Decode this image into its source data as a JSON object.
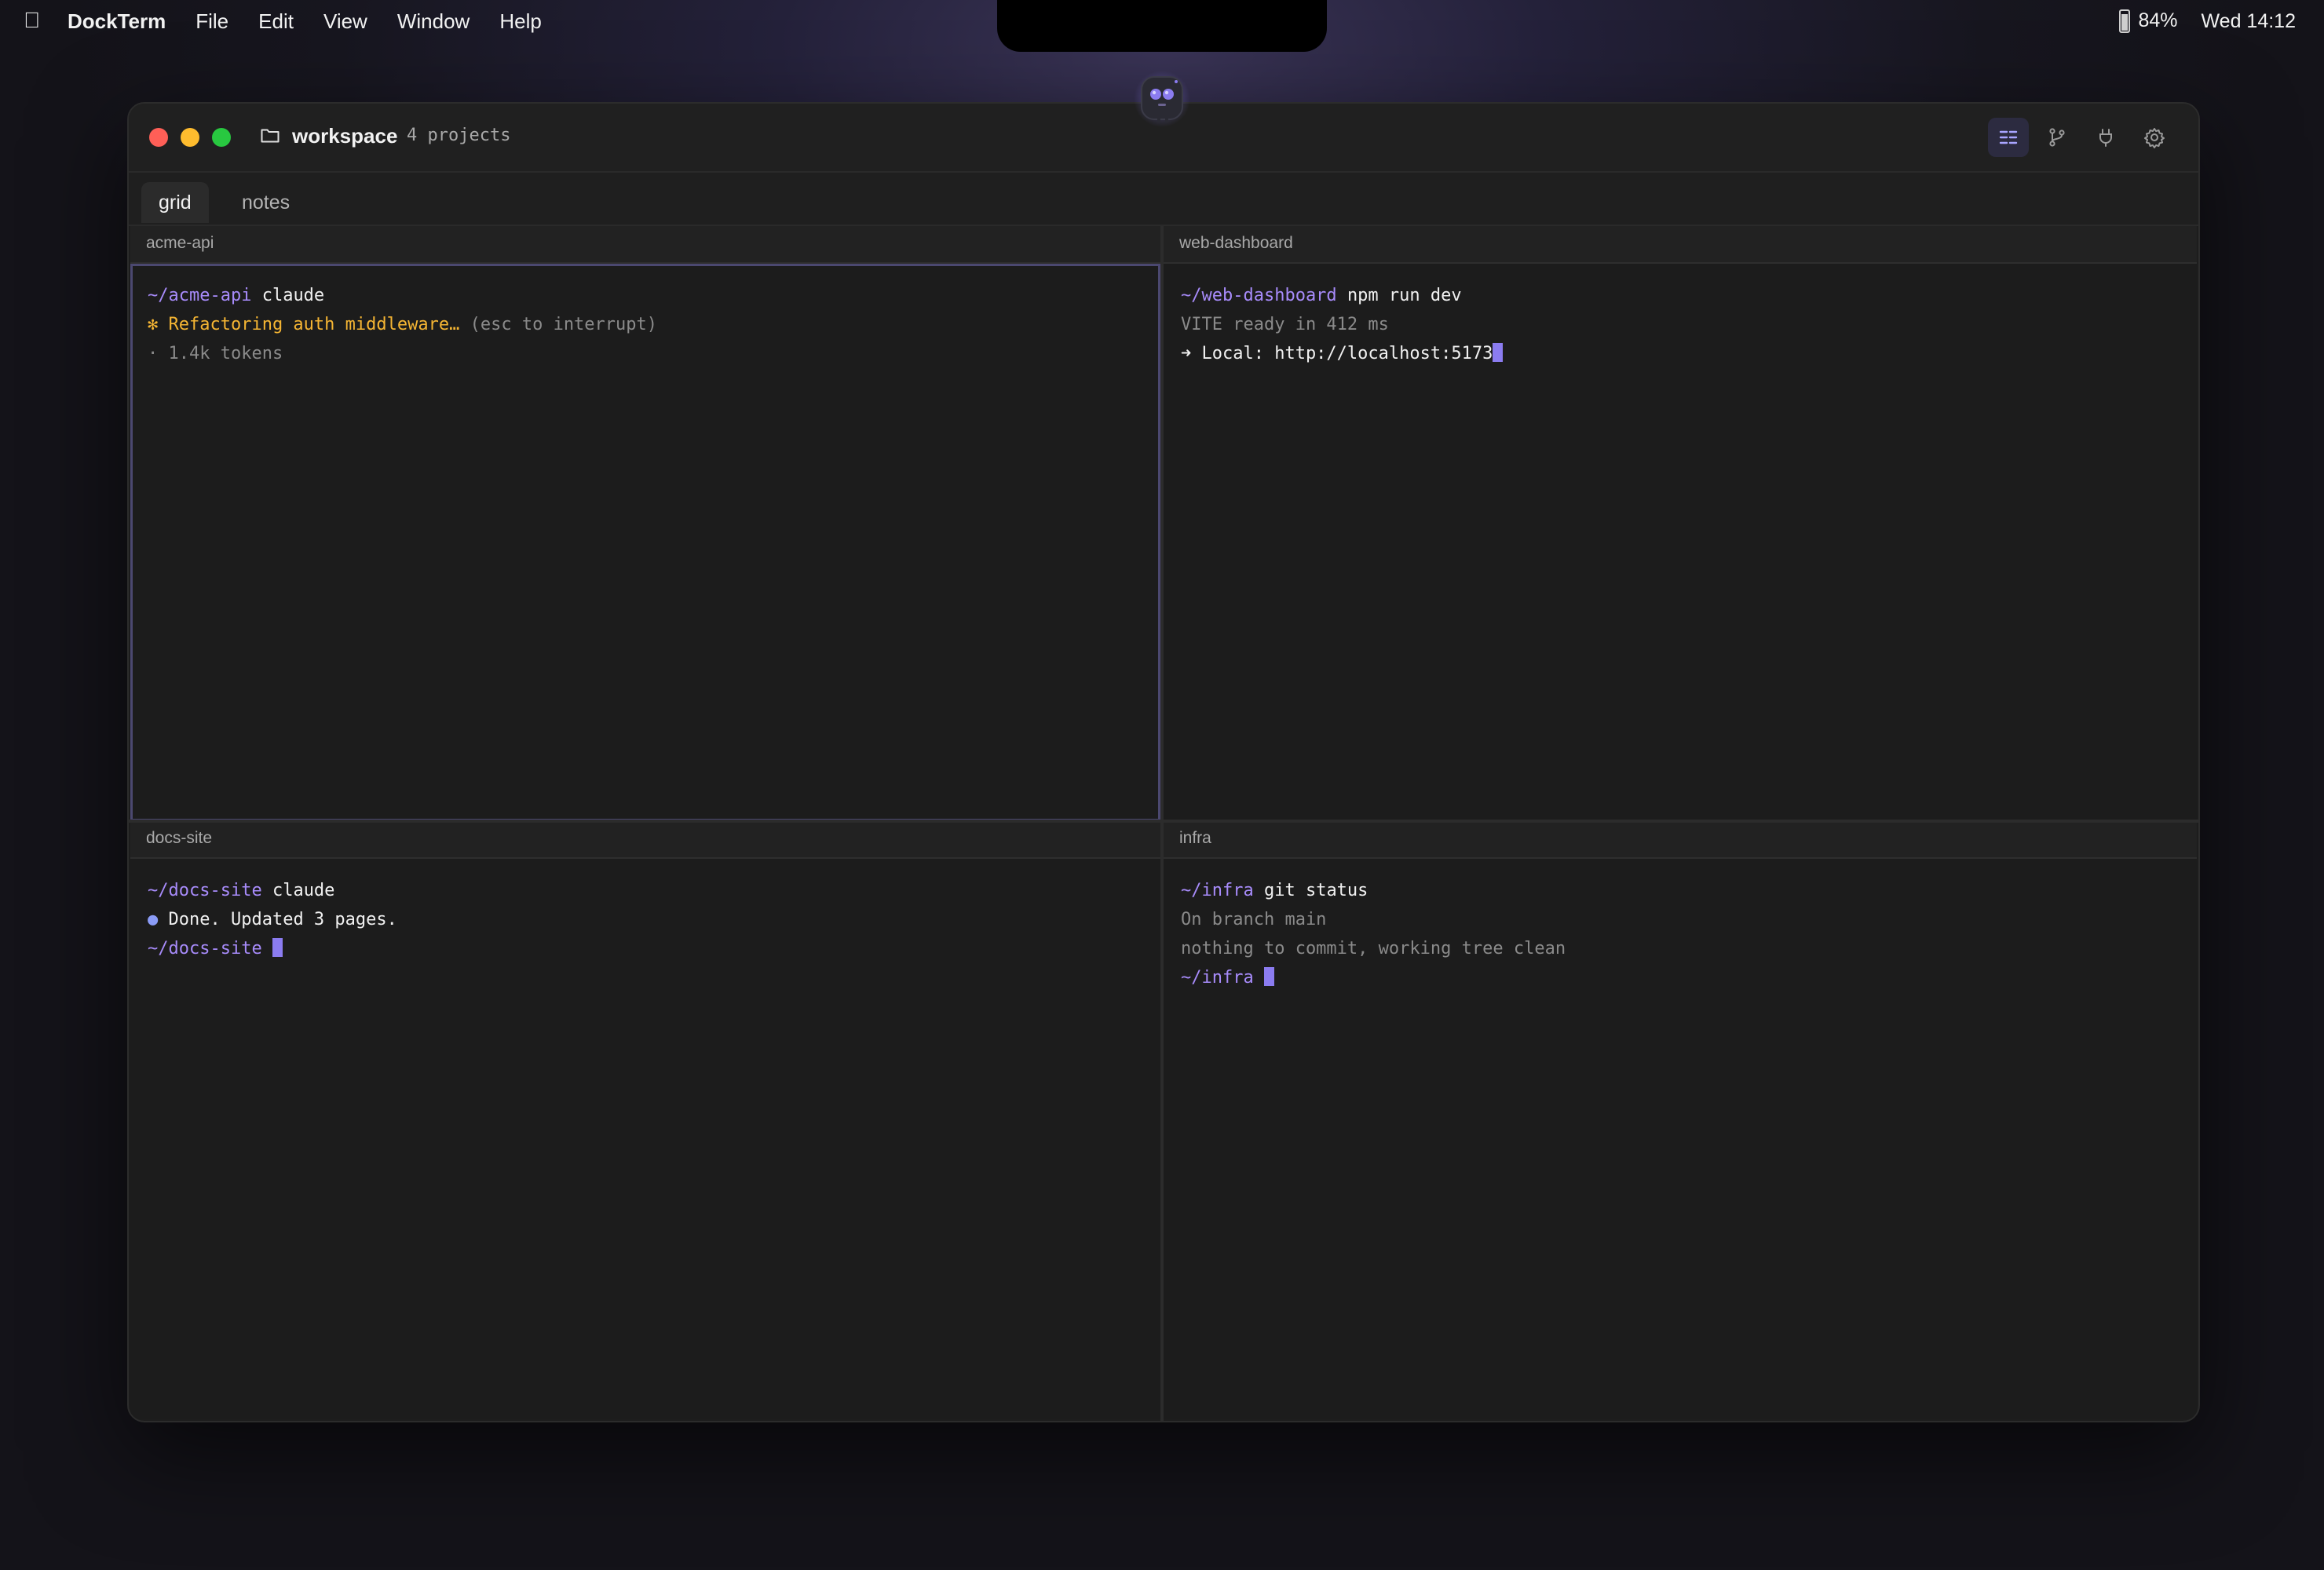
{
  "menubar": {
    "app_name": "DockTerm",
    "menus": [
      "File",
      "Edit",
      "View",
      "Window",
      "Help"
    ],
    "battery": "84%",
    "clock": "Wed 14:12"
  },
  "window": {
    "workspace_name": "workspace",
    "project_count": "4 projects",
    "toolbar_icons": [
      "grid-layout-icon",
      "git-branch-icon",
      "plug-icon",
      "gear-icon"
    ]
  },
  "tabs": [
    {
      "label": "grid",
      "active": true
    },
    {
      "label": "notes",
      "active": false
    }
  ],
  "panes": [
    {
      "title": "acme-api",
      "lines": [
        {
          "prompt": "~/acme-api",
          "cmd": "claude"
        },
        {
          "spinner": "✻ Refactoring auth middleware…",
          "hint": "(esc to interrupt)"
        },
        {
          "dim": "· 1.4k tokens"
        }
      ]
    },
    {
      "title": "web-dashboard",
      "lines": [
        {
          "prompt": "~/web-dashboard",
          "cmd": "npm run dev"
        },
        {
          "dim": "VITE ready in 412 ms"
        },
        {
          "text": "➜ Local: http://localhost:5173"
        }
      ]
    },
    {
      "title": "docs-site",
      "lines": [
        {
          "prompt": "~/docs-site",
          "cmd": "claude"
        },
        {
          "bullet": "●",
          "text": "Done. Updated 3 pages."
        },
        {
          "prompt": "~/docs-site"
        }
      ]
    },
    {
      "title": "infra",
      "lines": [
        {
          "prompt": "~/infra",
          "cmd": "git status"
        },
        {
          "dim": "On branch main"
        },
        {
          "dim": "nothing to commit, working tree clean"
        },
        {
          "prompt": "~/infra"
        }
      ]
    }
  ],
  "colors": {
    "accent": "#a78bfa",
    "cursor": "#8b7cf0",
    "spinner": "#f5b533",
    "traffic_red": "#ff5f57",
    "traffic_yellow": "#febc2e",
    "traffic_green": "#28c840"
  }
}
